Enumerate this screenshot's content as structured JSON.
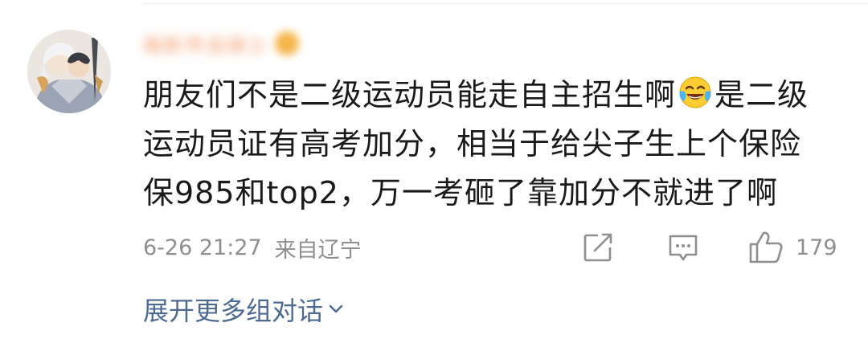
{
  "comment": {
    "username": "暗影传说骑士",
    "text_line1_before_emoji": "朋友们不是二级运动员能走自主招生啊",
    "emoji_name": "laugh-cry-emoji",
    "text_line1_after_emoji": "是二级",
    "text_line2": "运动员证有高考加分，相当于给尖子生上个保险",
    "text_line3": "保985和top2，万一考砸了靠加分不就进了啊",
    "timestamp": "6-26 21:27",
    "location": "来自辽宁",
    "like_count": "179"
  },
  "actions": {
    "share_icon": "share-icon",
    "reply_icon": "comment-icon",
    "like_icon": "thumbs-up-icon"
  },
  "footer": {
    "expand_label": "展开更多组对话",
    "expand_icon": "chevron-down-icon"
  },
  "colors": {
    "text": "#1a1a1a",
    "meta": "#8f8f8f",
    "link": "#4b6b95",
    "username": "#f39a6a"
  }
}
